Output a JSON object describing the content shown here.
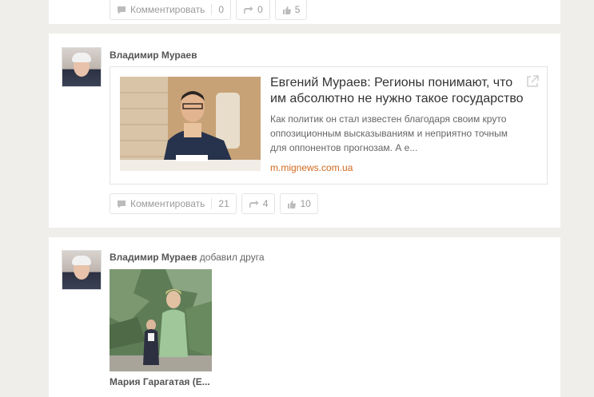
{
  "top_post": {
    "actions": {
      "comment_label": "Комментировать",
      "comment_count": "0",
      "reshare_count": "0",
      "like_count": "5"
    }
  },
  "link_post": {
    "author": "Владимир Мураев",
    "link": {
      "title": "Евгений Мураев: Регионы понимают, что им абсолютно не нужно такое государство",
      "description": "Как политик он стал известен благодаря своим круто оппозиционным высказываниям и неприятно точным для оппонентов прогнозам. А е...",
      "domain": "m.mignews.com.ua"
    },
    "actions": {
      "comment_label": "Комментировать",
      "comment_count": "21",
      "reshare_count": "4",
      "like_count": "10"
    }
  },
  "friend_post": {
    "author": "Владимир Мураев",
    "action_text": "добавил друга",
    "friend_name": "Мария Гарагатая (Е..."
  },
  "icons": {
    "comment": "comment-bubble-icon",
    "reshare": "reshare-arrow-icon",
    "like": "thumbs-up-icon",
    "external": "external-link-icon"
  }
}
